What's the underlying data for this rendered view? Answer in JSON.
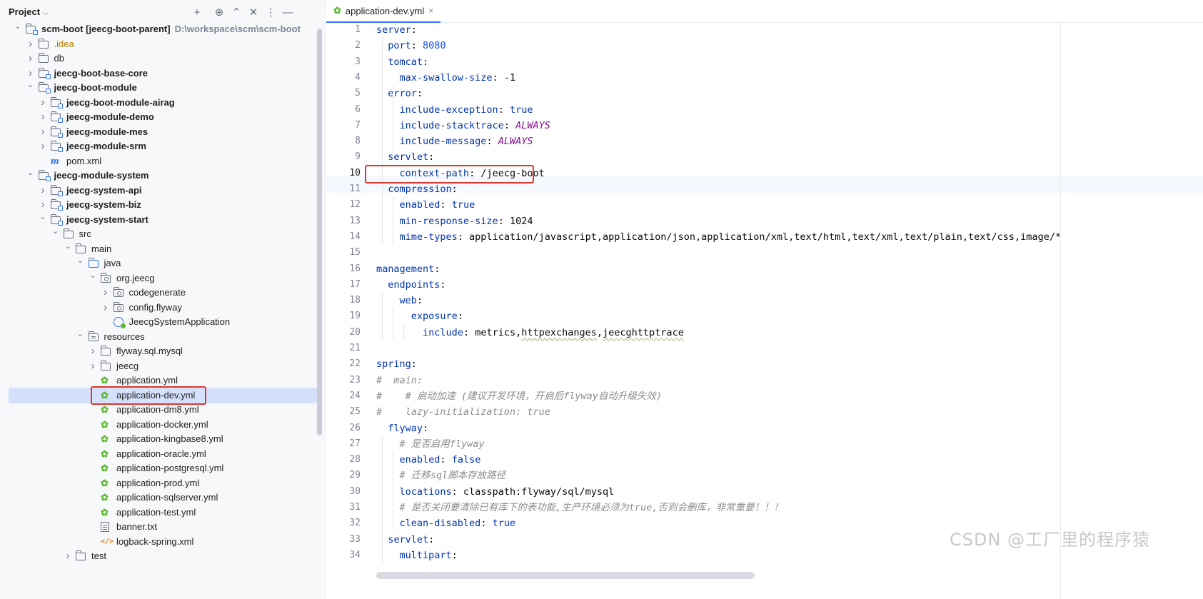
{
  "project_panel": {
    "title": "Project",
    "header_icons": [
      "add-icon",
      "locate-icon",
      "expand-all-icon",
      "collapse-all-icon",
      "more-icon",
      "hide-icon"
    ],
    "tree": [
      {
        "label": "scm-boot [jeecg-boot-parent]",
        "path": "D:\\workspace\\scm\\scm-boot",
        "icon": "module-folder-icon",
        "bold": true,
        "state": "expanded"
      },
      {
        "label": ".idea",
        "icon": "folder-icon",
        "bold": false,
        "excluded": true,
        "state": "collapsed"
      },
      {
        "label": "db",
        "icon": "folder-icon",
        "bold": false,
        "state": "collapsed"
      },
      {
        "label": "jeecg-boot-base-core",
        "icon": "module-folder-icon",
        "bold": true,
        "state": "collapsed"
      },
      {
        "label": "jeecg-boot-module",
        "icon": "module-folder-icon",
        "bold": true,
        "state": "expanded"
      },
      {
        "label": "jeecg-boot-module-airag",
        "icon": "module-folder-icon",
        "bold": true,
        "state": "collapsed"
      },
      {
        "label": "jeecg-module-demo",
        "icon": "module-folder-icon",
        "bold": true,
        "state": "collapsed"
      },
      {
        "label": "jeecg-module-mes",
        "icon": "module-folder-icon",
        "bold": true,
        "state": "collapsed"
      },
      {
        "label": "jeecg-module-srm",
        "icon": "module-folder-icon",
        "bold": true,
        "state": "collapsed"
      },
      {
        "label": "pom.xml",
        "icon": "maven-icon",
        "bold": false,
        "state": "leaf"
      },
      {
        "label": "jeecg-module-system",
        "icon": "module-folder-icon",
        "bold": true,
        "state": "expanded"
      },
      {
        "label": "jeecg-system-api",
        "icon": "module-folder-icon",
        "bold": true,
        "state": "collapsed"
      },
      {
        "label": "jeecg-system-biz",
        "icon": "module-folder-icon",
        "bold": true,
        "state": "collapsed"
      },
      {
        "label": "jeecg-system-start",
        "icon": "module-folder-icon",
        "bold": true,
        "state": "expanded"
      },
      {
        "label": "src",
        "icon": "folder-icon",
        "bold": false,
        "state": "expanded"
      },
      {
        "label": "main",
        "icon": "folder-icon",
        "bold": false,
        "state": "expanded"
      },
      {
        "label": "java",
        "icon": "source-folder-icon",
        "bold": false,
        "state": "expanded"
      },
      {
        "label": "org.jeecg",
        "icon": "package-icon",
        "bold": false,
        "state": "expanded"
      },
      {
        "label": "codegenerate",
        "icon": "package-icon",
        "bold": false,
        "state": "collapsed"
      },
      {
        "label": "config.flyway",
        "icon": "package-icon",
        "bold": false,
        "state": "collapsed"
      },
      {
        "label": "JeecgSystemApplication",
        "icon": "spring-boot-class-icon",
        "bold": false,
        "state": "leaf"
      },
      {
        "label": "resources",
        "icon": "resources-folder-icon",
        "bold": false,
        "state": "expanded"
      },
      {
        "label": "flyway.sql.mysql",
        "icon": "folder-icon",
        "bold": false,
        "state": "collapsed"
      },
      {
        "label": "jeecg",
        "icon": "folder-icon",
        "bold": false,
        "state": "collapsed"
      },
      {
        "label": "application.yml",
        "icon": "yaml-icon",
        "bold": false,
        "state": "leaf"
      },
      {
        "label": "application-dev.yml",
        "icon": "yaml-icon",
        "bold": false,
        "state": "leaf",
        "selected": true
      },
      {
        "label": "application-dm8.yml",
        "icon": "yaml-icon",
        "bold": false,
        "state": "leaf"
      },
      {
        "label": "application-docker.yml",
        "icon": "yaml-icon",
        "bold": false,
        "state": "leaf"
      },
      {
        "label": "application-kingbase8.yml",
        "icon": "yaml-icon",
        "bold": false,
        "state": "leaf"
      },
      {
        "label": "application-oracle.yml",
        "icon": "yaml-icon",
        "bold": false,
        "state": "leaf"
      },
      {
        "label": "application-postgresql.yml",
        "icon": "yaml-icon",
        "bold": false,
        "state": "leaf"
      },
      {
        "label": "application-prod.yml",
        "icon": "yaml-icon",
        "bold": false,
        "state": "leaf"
      },
      {
        "label": "application-sqlserver.yml",
        "icon": "yaml-icon",
        "bold": false,
        "state": "leaf"
      },
      {
        "label": "application-test.yml",
        "icon": "yaml-icon",
        "bold": false,
        "state": "leaf"
      },
      {
        "label": "banner.txt",
        "icon": "text-file-icon",
        "bold": false,
        "state": "leaf"
      },
      {
        "label": "logback-spring.xml",
        "icon": "xml-icon",
        "bold": false,
        "state": "leaf"
      },
      {
        "label": "test",
        "icon": "folder-icon",
        "bold": false,
        "state": "collapsed"
      }
    ]
  },
  "editor": {
    "tab": {
      "label": "application-dev.yml",
      "close": "×"
    },
    "current_line": 10,
    "lines": [
      {
        "n": "1",
        "t": [
          [
            "k",
            "server"
          ],
          [
            "p",
            ":"
          ]
        ]
      },
      {
        "n": "2",
        "t": [
          [
            "p",
            "  "
          ],
          [
            "k",
            "port"
          ],
          [
            "p",
            ": "
          ],
          [
            "n",
            "8080"
          ]
        ]
      },
      {
        "n": "3",
        "t": [
          [
            "p",
            "  "
          ],
          [
            "k",
            "tomcat"
          ],
          [
            "p",
            ":"
          ]
        ]
      },
      {
        "n": "4",
        "t": [
          [
            "p",
            "    "
          ],
          [
            "k",
            "max-swallow-size"
          ],
          [
            "p",
            ": -1"
          ]
        ]
      },
      {
        "n": "5",
        "t": [
          [
            "p",
            "  "
          ],
          [
            "k",
            "error"
          ],
          [
            "p",
            ":"
          ]
        ]
      },
      {
        "n": "6",
        "t": [
          [
            "p",
            "    "
          ],
          [
            "k",
            "include-exception"
          ],
          [
            "p",
            ": "
          ],
          [
            "b",
            "true"
          ]
        ]
      },
      {
        "n": "7",
        "t": [
          [
            "p",
            "    "
          ],
          [
            "k",
            "include-stacktrace"
          ],
          [
            "p",
            ": "
          ],
          [
            "e",
            "ALWAYS"
          ]
        ]
      },
      {
        "n": "8",
        "t": [
          [
            "p",
            "    "
          ],
          [
            "k",
            "include-message"
          ],
          [
            "p",
            ": "
          ],
          [
            "e",
            "ALWAYS"
          ]
        ]
      },
      {
        "n": "9",
        "t": [
          [
            "p",
            "  "
          ],
          [
            "k",
            "servlet"
          ],
          [
            "p",
            ":"
          ]
        ]
      },
      {
        "n": "10",
        "t": [
          [
            "p",
            "    "
          ],
          [
            "k",
            "context-path"
          ],
          [
            "p",
            ": /jeecg-boot"
          ]
        ]
      },
      {
        "n": "11",
        "t": [
          [
            "p",
            "  "
          ],
          [
            "k",
            "compression"
          ],
          [
            "p",
            ":"
          ]
        ]
      },
      {
        "n": "12",
        "t": [
          [
            "p",
            "    "
          ],
          [
            "k",
            "enabled"
          ],
          [
            "p",
            ": "
          ],
          [
            "b",
            "true"
          ]
        ]
      },
      {
        "n": "13",
        "t": [
          [
            "p",
            "    "
          ],
          [
            "k",
            "min-response-size"
          ],
          [
            "p",
            ": 1024"
          ]
        ]
      },
      {
        "n": "14",
        "t": [
          [
            "p",
            "    "
          ],
          [
            "k",
            "mime-types"
          ],
          [
            "p",
            ": application/javascript,application/json,application/xml,text/html,text/xml,text/plain,text/css,image/*"
          ]
        ]
      },
      {
        "n": "15",
        "t": []
      },
      {
        "n": "16",
        "t": [
          [
            "k",
            "management"
          ],
          [
            "p",
            ":"
          ]
        ]
      },
      {
        "n": "17",
        "t": [
          [
            "p",
            "  "
          ],
          [
            "k",
            "endpoints"
          ],
          [
            "p",
            ":"
          ]
        ]
      },
      {
        "n": "18",
        "t": [
          [
            "p",
            "    "
          ],
          [
            "k",
            "web"
          ],
          [
            "p",
            ":"
          ]
        ]
      },
      {
        "n": "19",
        "t": [
          [
            "p",
            "      "
          ],
          [
            "k",
            "exposure"
          ],
          [
            "p",
            ":"
          ]
        ]
      },
      {
        "n": "20",
        "t": [
          [
            "p",
            "        "
          ],
          [
            "k",
            "include"
          ],
          [
            "p",
            ": metrics,"
          ],
          [
            "u",
            "httpexchanges"
          ],
          [
            "p",
            ","
          ],
          [
            "u",
            "jeecghttptrace"
          ]
        ]
      },
      {
        "n": "21",
        "t": []
      },
      {
        "n": "22",
        "t": [
          [
            "k",
            "spring"
          ],
          [
            "p",
            ":"
          ]
        ]
      },
      {
        "n": "23",
        "t": [
          [
            "c",
            "#  main:"
          ]
        ]
      },
      {
        "n": "24",
        "t": [
          [
            "c",
            "#    # 启动加速 (建议开发环境，开启后flyway自动升级失效)"
          ]
        ]
      },
      {
        "n": "25",
        "t": [
          [
            "c",
            "#    lazy-initialization: true"
          ]
        ]
      },
      {
        "n": "26",
        "t": [
          [
            "p",
            "  "
          ],
          [
            "k",
            "flyway"
          ],
          [
            "p",
            ":"
          ]
        ]
      },
      {
        "n": "27",
        "t": [
          [
            "p",
            "    "
          ],
          [
            "c",
            "# 是否启用flyway"
          ]
        ]
      },
      {
        "n": "28",
        "t": [
          [
            "p",
            "    "
          ],
          [
            "k",
            "enabled"
          ],
          [
            "p",
            ": "
          ],
          [
            "b",
            "false"
          ]
        ]
      },
      {
        "n": "29",
        "t": [
          [
            "p",
            "    "
          ],
          [
            "c",
            "# 迁移sql脚本存放路径"
          ]
        ]
      },
      {
        "n": "30",
        "t": [
          [
            "p",
            "    "
          ],
          [
            "k",
            "locations"
          ],
          [
            "p",
            ": classpath:flyway/sql/mysql"
          ]
        ]
      },
      {
        "n": "31",
        "t": [
          [
            "p",
            "    "
          ],
          [
            "c",
            "# 是否关闭要清除已有库下的表功能,生产环境必须为true,否则会删库，非常重要！！！"
          ]
        ]
      },
      {
        "n": "32",
        "t": [
          [
            "p",
            "    "
          ],
          [
            "k",
            "clean-disabled"
          ],
          [
            "p",
            ": "
          ],
          [
            "b",
            "true"
          ]
        ]
      },
      {
        "n": "33",
        "t": [
          [
            "p",
            "  "
          ],
          [
            "k",
            "servlet"
          ],
          [
            "p",
            ":"
          ]
        ]
      },
      {
        "n": "34",
        "t": [
          [
            "p",
            "    "
          ],
          [
            "k",
            "multipart"
          ],
          [
            "p",
            ":"
          ]
        ]
      }
    ]
  },
  "watermark": "CSDN @工厂里的程序猿",
  "colors": {
    "accent": "#3574f0",
    "highlight_box": "#e0352b",
    "selection": "#d5e1fb"
  }
}
